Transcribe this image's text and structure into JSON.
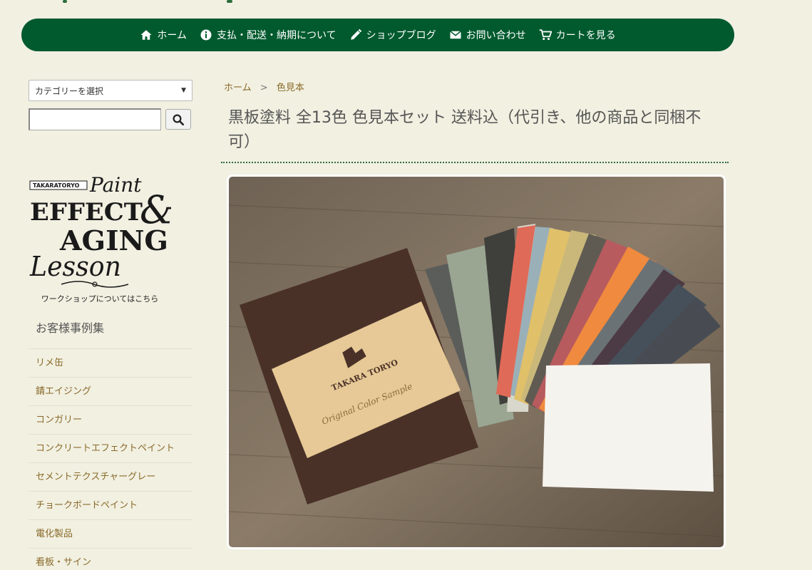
{
  "nav": {
    "items": [
      {
        "label": "ホーム",
        "icon": "home-icon"
      },
      {
        "label": "支払・配送・納期について",
        "icon": "info-icon"
      },
      {
        "label": "ショップブログ",
        "icon": "pencil-icon"
      },
      {
        "label": "お問い合わせ",
        "icon": "mail-icon"
      },
      {
        "label": "カートを見る",
        "icon": "cart-icon"
      }
    ]
  },
  "sidebar": {
    "category_select": "カテゴリーを選択",
    "search_value": "",
    "banner": {
      "brand": "TAKARATORYO",
      "line_paint": "Paint",
      "line_effect": "EFFECT",
      "line_amp": "&",
      "line_aging": "AGING",
      "line_lesson": "Lesson",
      "caption": "ワークショップについてはこちら"
    },
    "section_title": "お客様事例集",
    "categories": [
      "リメ缶",
      "錆エイジング",
      "コンガリー",
      "コンクリートエフェクトペイント",
      "セメントテクスチャーグレー",
      "チョークボードペイント",
      "電化製品",
      "看板・サイン"
    ]
  },
  "breadcrumb": {
    "home": "ホーム",
    "sep": ">",
    "current": "色見本"
  },
  "product": {
    "title": "黒板塗料 全13色 色見本セット 送料込（代引き、他の商品と同梱不可）",
    "box_brand": "TAKARA TORYO",
    "box_subtitle": "Original Color Sample"
  },
  "colors": {
    "nav_bg": "#005a2e",
    "page_bg": "#f1f0e1",
    "link": "#8a6a2a"
  }
}
